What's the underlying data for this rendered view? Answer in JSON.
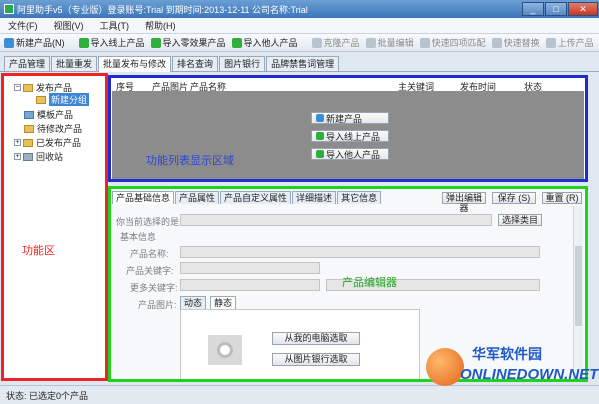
{
  "window": {
    "title": "阿里助手v5（专业版）登录账号:Trial   到期时间:2013-12-11   公司名称:Trial",
    "buttons": {
      "min": "_",
      "max": "□",
      "close": "✕"
    }
  },
  "menu": [
    "文件(F)",
    "视图(V)",
    "工具(T)",
    "帮助(H)"
  ],
  "toolbar": [
    {
      "label": "新建产品(N)",
      "icon": "new-product-icon",
      "color": "#3c8fd6",
      "disabled": false
    },
    {
      "label": "导入线上产品",
      "icon": "import-online-icon",
      "color": "#2fae3c",
      "disabled": false
    },
    {
      "label": "导入零效果产品",
      "icon": "import-zero-icon",
      "color": "#2fae3c",
      "disabled": false
    },
    {
      "label": "导入他人产品",
      "icon": "import-others-icon",
      "color": "#2fae3c",
      "disabled": false
    },
    {
      "label": "克隆产品",
      "icon": "clone-icon",
      "color": "#b9c3cf",
      "disabled": true
    },
    {
      "label": "批量编辑",
      "icon": "batch-edit-icon",
      "color": "#b9c3cf",
      "disabled": true
    },
    {
      "label": "快速四项匹配",
      "icon": "quick-match-icon",
      "color": "#b9c3cf",
      "disabled": true
    },
    {
      "label": "快速替换",
      "icon": "quick-replace-icon",
      "color": "#b9c3cf",
      "disabled": true
    },
    {
      "label": "上传产品",
      "icon": "upload-icon",
      "color": "#b9c3cf",
      "disabled": true
    }
  ],
  "toolbar_right_icons": [
    "tools-icon",
    "settings-icon",
    "help-icon"
  ],
  "main_tabs": [
    {
      "label": "产品管理",
      "active": false
    },
    {
      "label": "批量重发",
      "active": false
    },
    {
      "label": "批量发布与修改",
      "active": true
    },
    {
      "label": "排名查询",
      "active": false
    },
    {
      "label": "图片银行",
      "active": false
    },
    {
      "label": "品牌禁售词管理",
      "active": false
    }
  ],
  "tree": {
    "publish": "发布产品",
    "new_group": "新建分组",
    "template": "模板产品",
    "to_modify": "待修改产品",
    "published": "已发布产品",
    "recycle": "回收站"
  },
  "list": {
    "columns": [
      "序号",
      "产品图片",
      "产品名称",
      "主关键词",
      "发布时间",
      "状态"
    ],
    "actions": [
      "新建产品",
      "导入线上产品",
      "导入他人产品"
    ]
  },
  "editor": {
    "tabs": [
      "产品基础信息",
      "产品属性",
      "产品自定义属性",
      "详细描述",
      "其它信息"
    ],
    "buttons": {
      "popup": "弹出编辑器",
      "save": "保存 (S)",
      "reset": "重置 (R)"
    },
    "selected_category_label": "你当前选择的是:",
    "choose_category": "选择类目",
    "basic_info": "基本信息",
    "fields": [
      "产品名称:",
      "产品关键字:",
      "更多关键字:"
    ],
    "image_label": "产品图片:",
    "image_tabs": [
      "动态",
      "静态"
    ],
    "image_buttons": [
      "从我的电脑选取",
      "从图片银行选取"
    ]
  },
  "annotations": {
    "left": "功能区",
    "top": "功能列表显示区域",
    "bottom": "产品编辑器",
    "colors": {
      "left": "#ee2424",
      "top": "#1f2dd0",
      "bottom": "#1ed31e"
    }
  },
  "status": "状态:  已选定0个产品",
  "watermark": {
    "cn": "华军软件园",
    "en": "ONLINEDOWN.NET"
  }
}
